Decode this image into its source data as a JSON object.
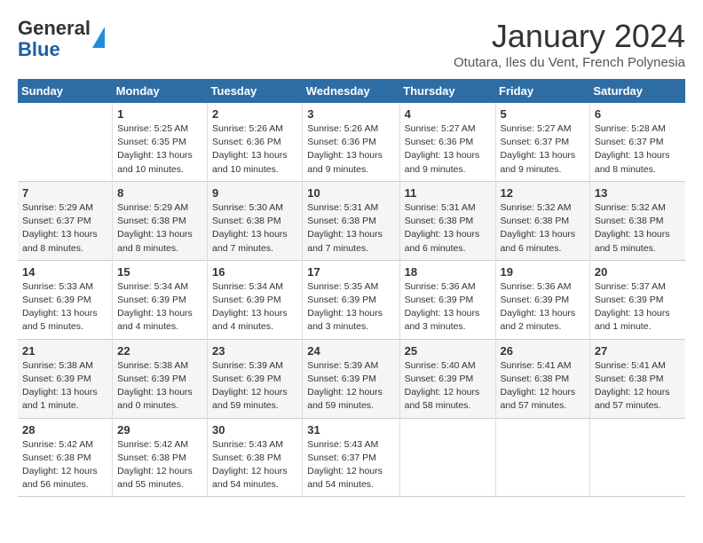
{
  "logo": {
    "general": "General",
    "blue": "Blue"
  },
  "title": "January 2024",
  "subtitle": "Otutara, Iles du Vent, French Polynesia",
  "days_of_week": [
    "Sunday",
    "Monday",
    "Tuesday",
    "Wednesday",
    "Thursday",
    "Friday",
    "Saturday"
  ],
  "weeks": [
    [
      {
        "day": "",
        "info": ""
      },
      {
        "day": "1",
        "info": "Sunrise: 5:25 AM\nSunset: 6:35 PM\nDaylight: 13 hours\nand 10 minutes."
      },
      {
        "day": "2",
        "info": "Sunrise: 5:26 AM\nSunset: 6:36 PM\nDaylight: 13 hours\nand 10 minutes."
      },
      {
        "day": "3",
        "info": "Sunrise: 5:26 AM\nSunset: 6:36 PM\nDaylight: 13 hours\nand 9 minutes."
      },
      {
        "day": "4",
        "info": "Sunrise: 5:27 AM\nSunset: 6:36 PM\nDaylight: 13 hours\nand 9 minutes."
      },
      {
        "day": "5",
        "info": "Sunrise: 5:27 AM\nSunset: 6:37 PM\nDaylight: 13 hours\nand 9 minutes."
      },
      {
        "day": "6",
        "info": "Sunrise: 5:28 AM\nSunset: 6:37 PM\nDaylight: 13 hours\nand 8 minutes."
      }
    ],
    [
      {
        "day": "7",
        "info": "Sunrise: 5:29 AM\nSunset: 6:37 PM\nDaylight: 13 hours\nand 8 minutes."
      },
      {
        "day": "8",
        "info": "Sunrise: 5:29 AM\nSunset: 6:38 PM\nDaylight: 13 hours\nand 8 minutes."
      },
      {
        "day": "9",
        "info": "Sunrise: 5:30 AM\nSunset: 6:38 PM\nDaylight: 13 hours\nand 7 minutes."
      },
      {
        "day": "10",
        "info": "Sunrise: 5:31 AM\nSunset: 6:38 PM\nDaylight: 13 hours\nand 7 minutes."
      },
      {
        "day": "11",
        "info": "Sunrise: 5:31 AM\nSunset: 6:38 PM\nDaylight: 13 hours\nand 6 minutes."
      },
      {
        "day": "12",
        "info": "Sunrise: 5:32 AM\nSunset: 6:38 PM\nDaylight: 13 hours\nand 6 minutes."
      },
      {
        "day": "13",
        "info": "Sunrise: 5:32 AM\nSunset: 6:38 PM\nDaylight: 13 hours\nand 5 minutes."
      }
    ],
    [
      {
        "day": "14",
        "info": "Sunrise: 5:33 AM\nSunset: 6:39 PM\nDaylight: 13 hours\nand 5 minutes."
      },
      {
        "day": "15",
        "info": "Sunrise: 5:34 AM\nSunset: 6:39 PM\nDaylight: 13 hours\nand 4 minutes."
      },
      {
        "day": "16",
        "info": "Sunrise: 5:34 AM\nSunset: 6:39 PM\nDaylight: 13 hours\nand 4 minutes."
      },
      {
        "day": "17",
        "info": "Sunrise: 5:35 AM\nSunset: 6:39 PM\nDaylight: 13 hours\nand 3 minutes."
      },
      {
        "day": "18",
        "info": "Sunrise: 5:36 AM\nSunset: 6:39 PM\nDaylight: 13 hours\nand 3 minutes."
      },
      {
        "day": "19",
        "info": "Sunrise: 5:36 AM\nSunset: 6:39 PM\nDaylight: 13 hours\nand 2 minutes."
      },
      {
        "day": "20",
        "info": "Sunrise: 5:37 AM\nSunset: 6:39 PM\nDaylight: 13 hours\nand 1 minute."
      }
    ],
    [
      {
        "day": "21",
        "info": "Sunrise: 5:38 AM\nSunset: 6:39 PM\nDaylight: 13 hours\nand 1 minute."
      },
      {
        "day": "22",
        "info": "Sunrise: 5:38 AM\nSunset: 6:39 PM\nDaylight: 13 hours\nand 0 minutes."
      },
      {
        "day": "23",
        "info": "Sunrise: 5:39 AM\nSunset: 6:39 PM\nDaylight: 12 hours\nand 59 minutes."
      },
      {
        "day": "24",
        "info": "Sunrise: 5:39 AM\nSunset: 6:39 PM\nDaylight: 12 hours\nand 59 minutes."
      },
      {
        "day": "25",
        "info": "Sunrise: 5:40 AM\nSunset: 6:39 PM\nDaylight: 12 hours\nand 58 minutes."
      },
      {
        "day": "26",
        "info": "Sunrise: 5:41 AM\nSunset: 6:38 PM\nDaylight: 12 hours\nand 57 minutes."
      },
      {
        "day": "27",
        "info": "Sunrise: 5:41 AM\nSunset: 6:38 PM\nDaylight: 12 hours\nand 57 minutes."
      }
    ],
    [
      {
        "day": "28",
        "info": "Sunrise: 5:42 AM\nSunset: 6:38 PM\nDaylight: 12 hours\nand 56 minutes."
      },
      {
        "day": "29",
        "info": "Sunrise: 5:42 AM\nSunset: 6:38 PM\nDaylight: 12 hours\nand 55 minutes."
      },
      {
        "day": "30",
        "info": "Sunrise: 5:43 AM\nSunset: 6:38 PM\nDaylight: 12 hours\nand 54 minutes."
      },
      {
        "day": "31",
        "info": "Sunrise: 5:43 AM\nSunset: 6:37 PM\nDaylight: 12 hours\nand 54 minutes."
      },
      {
        "day": "",
        "info": ""
      },
      {
        "day": "",
        "info": ""
      },
      {
        "day": "",
        "info": ""
      }
    ]
  ]
}
